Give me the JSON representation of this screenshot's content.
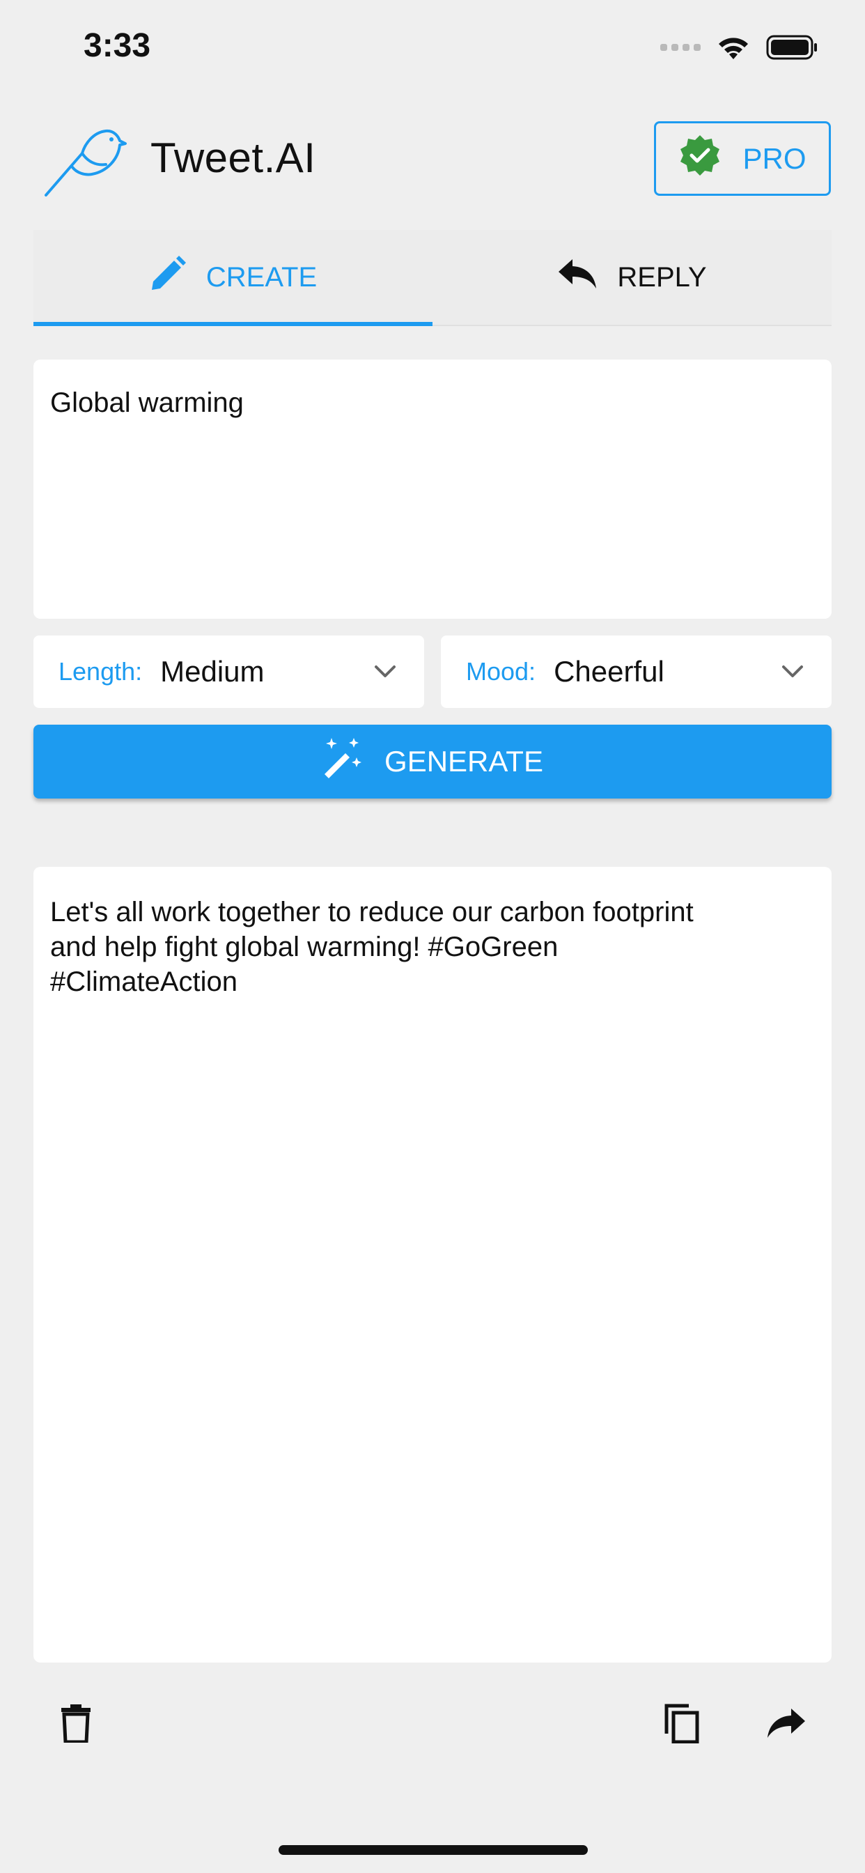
{
  "status_bar": {
    "time": "3:33"
  },
  "header": {
    "app_title": "Tweet.AI",
    "pro_label": "PRO"
  },
  "tabs": [
    {
      "label": "CREATE",
      "icon": "pencil-icon",
      "active": true
    },
    {
      "label": "REPLY",
      "icon": "reply-icon",
      "active": false
    }
  ],
  "topic_input": {
    "value": "Global warming"
  },
  "length_select": {
    "label": "Length:",
    "value": "Medium"
  },
  "mood_select": {
    "label": "Mood:",
    "value": "Cheerful"
  },
  "generate": {
    "label": "GENERATE",
    "icon": "magic-wand-icon"
  },
  "output": {
    "text": "Let's all work together to reduce our carbon footprint\nand help fight global warming! #GoGreen\n#ClimateAction"
  },
  "toolbar": {
    "icons": [
      "trash-icon",
      "copy-icon",
      "share-icon"
    ]
  },
  "colors": {
    "accent": "#1d9bf0",
    "pro_badge": "#3a9a3f",
    "background": "#efefef"
  }
}
